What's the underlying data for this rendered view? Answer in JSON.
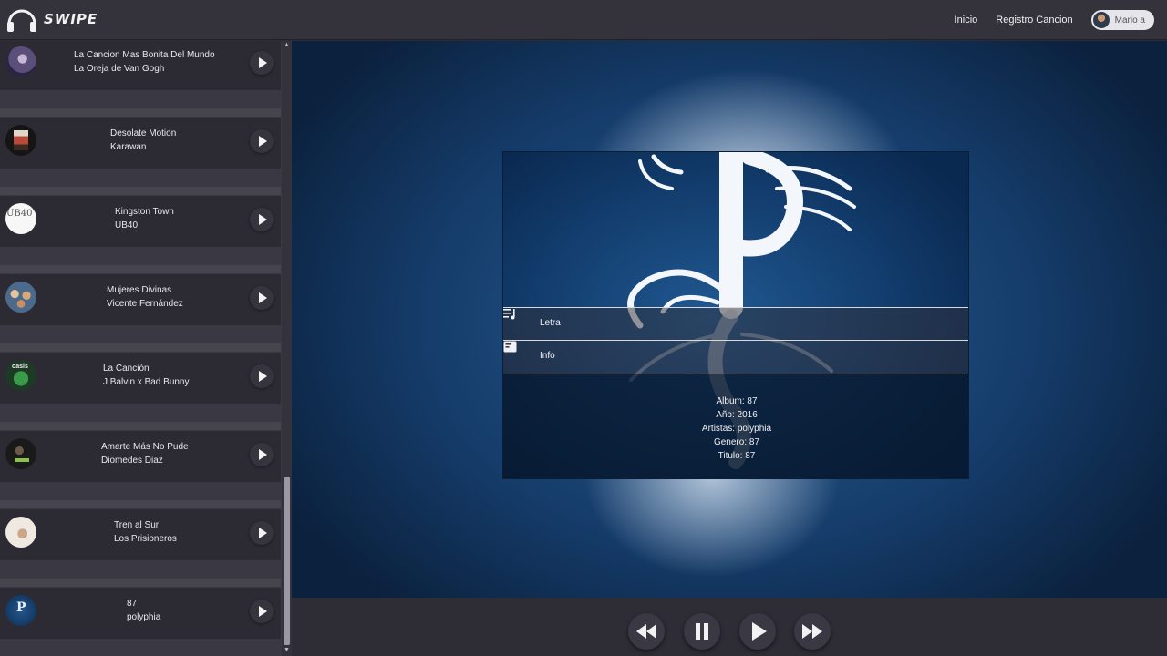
{
  "app": {
    "logo_text": "SWIPE",
    "nav": {
      "home": "Inicio",
      "register": "Registro Cancion"
    },
    "user_name": "Mario a"
  },
  "songs": [
    {
      "title": "La Cancion Mas Bonita Del Mundo",
      "artist": "La Oreja de Van Gogh",
      "thumb_icon": "cover-purple-figure"
    },
    {
      "title": "Desolate Motion",
      "artist": "Karawan",
      "thumb_icon": "cover-red-poster"
    },
    {
      "title": "Kingston Town",
      "artist": "UB40",
      "thumb_icon": "cover-ub40-white"
    },
    {
      "title": "Mujeres Divinas",
      "artist": "Vicente Fernández",
      "thumb_icon": "cover-cartoon-faces"
    },
    {
      "title": "La Canción",
      "artist": "J Balvin x Bad Bunny",
      "thumb_icon": "cover-oasis-green"
    },
    {
      "title": "Amarte Más No Pude",
      "artist": "Diomedes Diaz",
      "thumb_icon": "cover-dark-portrait"
    },
    {
      "title": "Tren al Sur",
      "artist": "Los Prisioneros",
      "thumb_icon": "cover-white-sketch"
    },
    {
      "title": "87",
      "artist": "polyphia",
      "thumb_icon": "cover-polyphia-blue"
    }
  ],
  "now_playing": {
    "tabs": {
      "lyrics": "Letra",
      "info": "Info"
    },
    "info": {
      "album": "Album: 87",
      "year": "Año: 2016",
      "artists": "Artistas: polyphia",
      "genre": "Genero: 87",
      "title": "Titulo: 87"
    }
  },
  "player_controls": [
    "rewind-icon",
    "pause-icon",
    "play-icon",
    "fast-forward-icon"
  ],
  "colors": {
    "topbar": "#34323b",
    "sidebar": "#3a3842",
    "cover_blue": "#123c6c",
    "text": "#e9e9ee"
  }
}
